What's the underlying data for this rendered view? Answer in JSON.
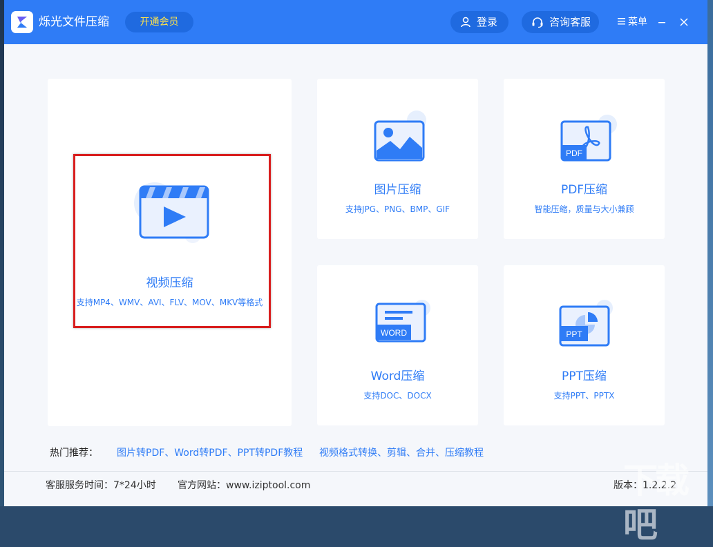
{
  "app": {
    "title": "烁光文件压缩",
    "vip_label": "开通会员",
    "login_label": "登录",
    "support_label": "咨询客服",
    "menu_label": "菜单"
  },
  "cards": {
    "video": {
      "title": "视频压缩",
      "desc": "支持MP4、WMV、AVI、FLV、MOV、MKV等格式"
    },
    "image": {
      "title": "图片压缩",
      "desc": "支持JPG、PNG、BMP、GIF"
    },
    "pdf": {
      "title": "PDF压缩",
      "desc": "智能压缩，质量与大小兼顾",
      "icon_text": "PDF"
    },
    "word": {
      "title": "Word压缩",
      "desc": "支持DOC、DOCX",
      "icon_text": "WORD"
    },
    "ppt": {
      "title": "PPT压缩",
      "desc": "支持PPT、PPTX",
      "icon_text": "PPT"
    }
  },
  "hot": {
    "label": "热门推荐：",
    "links": [
      "图片转PDF、Word转PDF、PPT转PDF教程",
      "视频格式转换、剪辑、合并、压缩教程"
    ]
  },
  "status": {
    "service_hours": "客服服务时间：7*24小时",
    "website": "官方网站：www.iziptool.com",
    "version": "版本：1.2.2.2"
  },
  "colors": {
    "accent": "#2f7cf6",
    "highlight": "#d81e1e",
    "vip_text": "#ffe34a"
  },
  "watermark": "下载吧"
}
